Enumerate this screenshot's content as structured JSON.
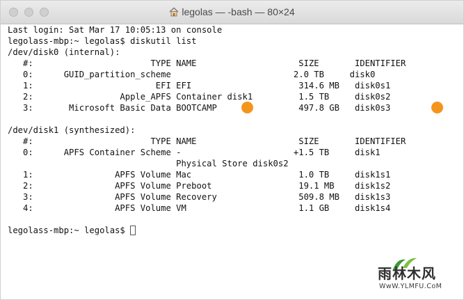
{
  "window": {
    "title": "legolas — -bash — 80×24",
    "accent_marker_color": "#f5941d"
  },
  "terminal": {
    "lines": [
      "Last login: Sat Mar 17 10:05:13 on console",
      "legolass-mbp:~ legolas$ diskutil list",
      "/dev/disk0 (internal):",
      "   #:                       TYPE NAME                    SIZE       IDENTIFIER",
      "   0:      GUID_partition_scheme                        2.0 TB     disk0",
      "   1:                        EFI EFI                     314.6 MB   disk0s1",
      "   2:                 Apple_APFS Container disk1         1.5 TB     disk0s2",
      "   3:       Microsoft Basic Data BOOTCAMP                497.8 GB   disk0s3",
      "",
      "/dev/disk1 (synthesized):",
      "   #:                       TYPE NAME                    SIZE       IDENTIFIER",
      "   0:      APFS Container Scheme -                      +1.5 TB     disk1",
      "                                 Physical Store disk0s2",
      "   1:                APFS Volume Mac                     1.0 TB     disk1s1",
      "   2:                APFS Volume Preboot                 19.1 MB    disk1s2",
      "   3:                APFS Volume Recovery                509.8 MB   disk1s3",
      "   4:                APFS Volume VM                      1.1 GB     disk1s4",
      "",
      "legolass-mbp:~ legolas$ "
    ]
  },
  "watermark": {
    "main": "雨林木风",
    "url": "WwW.YLMFU.CoM"
  }
}
